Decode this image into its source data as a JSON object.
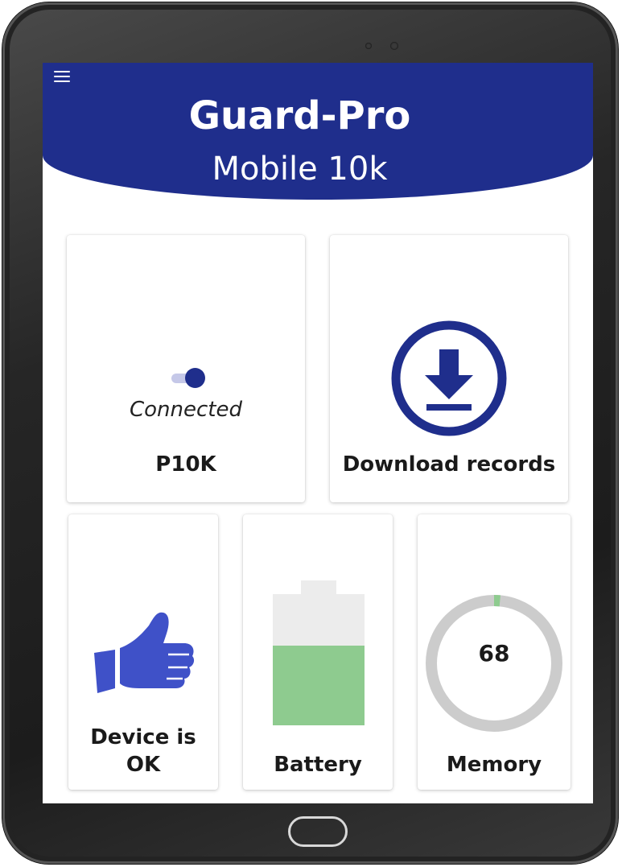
{
  "header": {
    "title": "Guard-Pro",
    "subtitle": "Mobile 10k",
    "menu_icon": "hamburger-menu-icon",
    "background_color": "#1f2e8c"
  },
  "cards": {
    "connection": {
      "status": "Connected",
      "device_name": "P10K",
      "toggle_on": true,
      "icon": "toggle-switch-icon"
    },
    "download": {
      "label": "Download records",
      "icon": "download-circle-icon"
    },
    "device_status": {
      "label_line1": "Device is",
      "label_line2": "OK",
      "icon": "thumbs-up-icon"
    },
    "battery": {
      "label": "Battery",
      "level_fraction": 0.61,
      "fill_color": "#8ecb8f"
    },
    "memory": {
      "label": "Memory",
      "value": "68",
      "used_fraction": 0.015,
      "ring_color": "#cccccc",
      "used_color": "#8ecb8f"
    }
  },
  "colors": {
    "accent": "#1f2e8c",
    "icon_blue": "#3f51c8"
  }
}
